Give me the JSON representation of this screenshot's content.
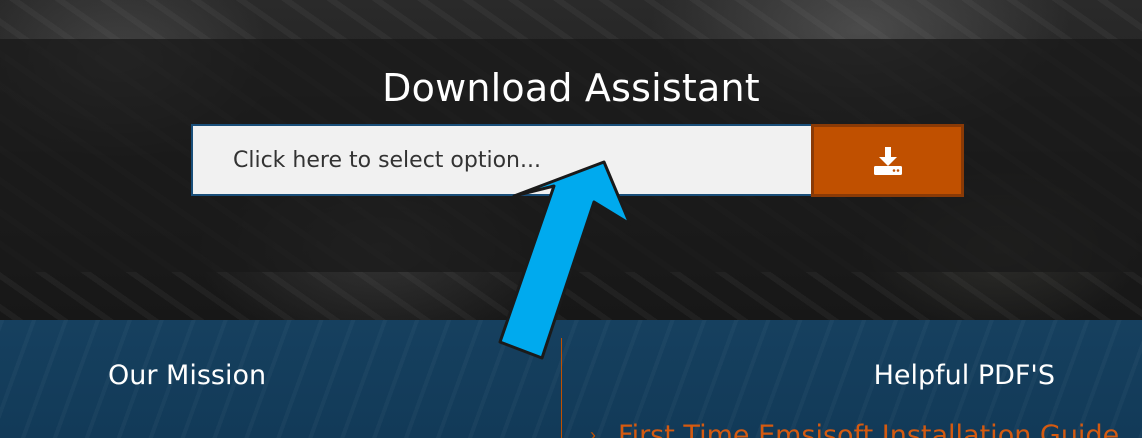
{
  "hero": {
    "title": "Download Assistant",
    "select": {
      "placeholder": "Click here to select option..."
    },
    "download_button": {
      "icon": "download-tray-icon",
      "color": "#c05000"
    }
  },
  "footer": {
    "mission_heading": "Our Mission",
    "pdf_heading": "Helpful PDF'S",
    "pdf_links": [
      "First Time Emsisoft Installation Guide"
    ],
    "accent_color": "#c05000",
    "background_color": "#16405f"
  },
  "annotation": {
    "arrow_color": "#00aaee",
    "arrow_icon": "pointer-arrow-icon"
  }
}
